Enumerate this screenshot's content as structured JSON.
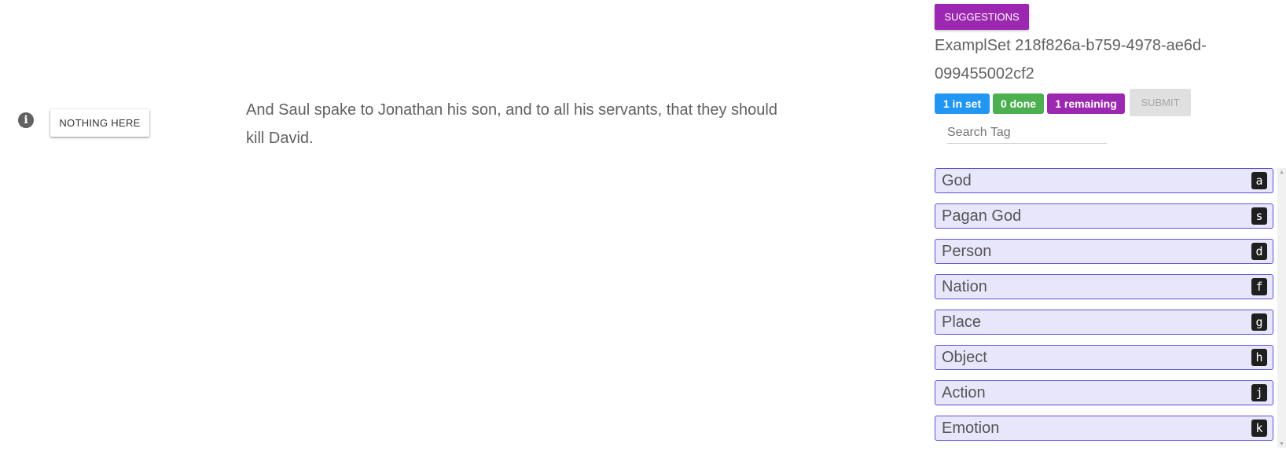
{
  "left": {
    "info_icon": "info-icon",
    "nothing_button": "NOTHING HERE"
  },
  "verse_text": "And Saul spake to Jonathan his son, and to all his servants, that they should kill David.",
  "panel": {
    "suggestions_button": "SUGGESTIONS",
    "set_title": "ExamplSet 218f826a-b759-4978-ae6d-099455002cf2",
    "badges": {
      "in_set": "1 in set",
      "done": "0 done",
      "remaining": "1 remaining"
    },
    "submit_button": "SUBMIT",
    "search_placeholder": "Search Tag",
    "tags": [
      {
        "label": "God",
        "key": "a"
      },
      {
        "label": "Pagan God",
        "key": "s"
      },
      {
        "label": "Person",
        "key": "d"
      },
      {
        "label": "Nation",
        "key": "f"
      },
      {
        "label": "Place",
        "key": "g"
      },
      {
        "label": "Object",
        "key": "h"
      },
      {
        "label": "Action",
        "key": "j"
      },
      {
        "label": "Emotion",
        "key": "k"
      }
    ]
  },
  "colors": {
    "purple": "#9c27b0",
    "blue": "#2196f3",
    "green": "#4caf50",
    "tag_bg": "#e8e6fb",
    "tag_border": "#5a52d5"
  }
}
